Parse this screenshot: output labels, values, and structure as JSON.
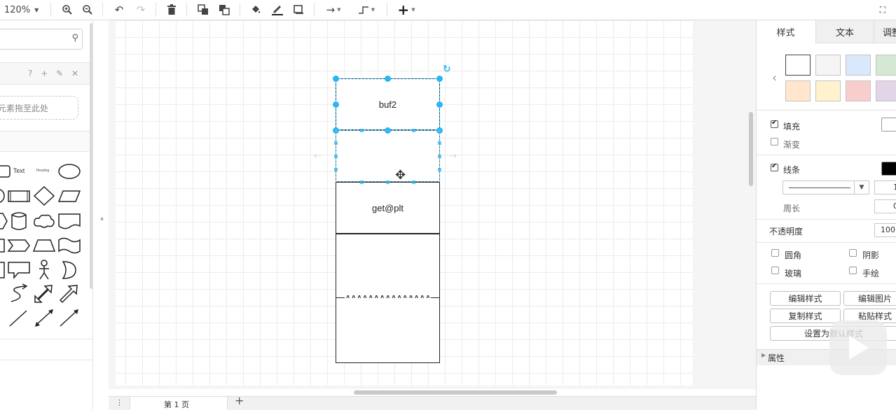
{
  "toolbar": {
    "zoom": "120%",
    "icons": [
      "zoom-in-icon",
      "zoom-out-icon",
      "undo-icon",
      "redo-icon",
      "delete-icon",
      "to-front-icon",
      "to-back-icon",
      "fill-color-icon",
      "line-color-icon",
      "shadow-icon",
      "connection-icon",
      "waypoints-icon",
      "insert-icon",
      "fullscreen-icon"
    ]
  },
  "sidebar": {
    "search_placeholder": "",
    "scratchpad_icons": "? + ✎ ✕",
    "drop_hint": "元素拖至此处",
    "text_shape": "Text",
    "heading_shape": "Heading"
  },
  "diagram": {
    "boxes": [
      "buf2",
      "",
      "get@plt",
      "",
      "AAAAAAAAAAAAAAA",
      ""
    ]
  },
  "page_tabs": {
    "current": "第 1 页",
    "add": "+"
  },
  "format_panel": {
    "tabs": [
      "样式",
      "文本",
      "调整"
    ],
    "swatches": [
      {
        "fill": "#ffffff",
        "stroke": "#000000"
      },
      {
        "fill": "#f5f5f5",
        "stroke": "#666666"
      },
      {
        "fill": "#dae8fc",
        "stroke": "#6c8ebf"
      },
      {
        "fill": "#d5e8d4",
        "stroke": "#82b366"
      },
      {
        "fill": "#ffe6cc",
        "stroke": "#d79b00"
      },
      {
        "fill": "#fff2cc",
        "stroke": "#d6b656"
      },
      {
        "fill": "#f8cecc",
        "stroke": "#b85450"
      },
      {
        "fill": "#e1d5e7",
        "stroke": "#9673a6"
      }
    ],
    "fill_label": "填充",
    "fill_checked": true,
    "gradient_label": "渐变",
    "gradient_checked": false,
    "line_label": "线条",
    "line_checked": true,
    "line_width": "1",
    "perimeter_label": "周长",
    "perimeter_value": "0",
    "opacity_label": "不透明度",
    "opacity_value": "100",
    "rounded_label": "圆角",
    "shadow_label": "阴影",
    "glass_label": "玻璃",
    "sketch_label": "手绘",
    "edit_style_button": "编辑样式",
    "edit_image_button": "编辑图片",
    "copy_style_button": "复制样式",
    "paste_style_button": "粘贴样式",
    "set_default_button": "设置为默认样式",
    "properties_label": "属性"
  }
}
